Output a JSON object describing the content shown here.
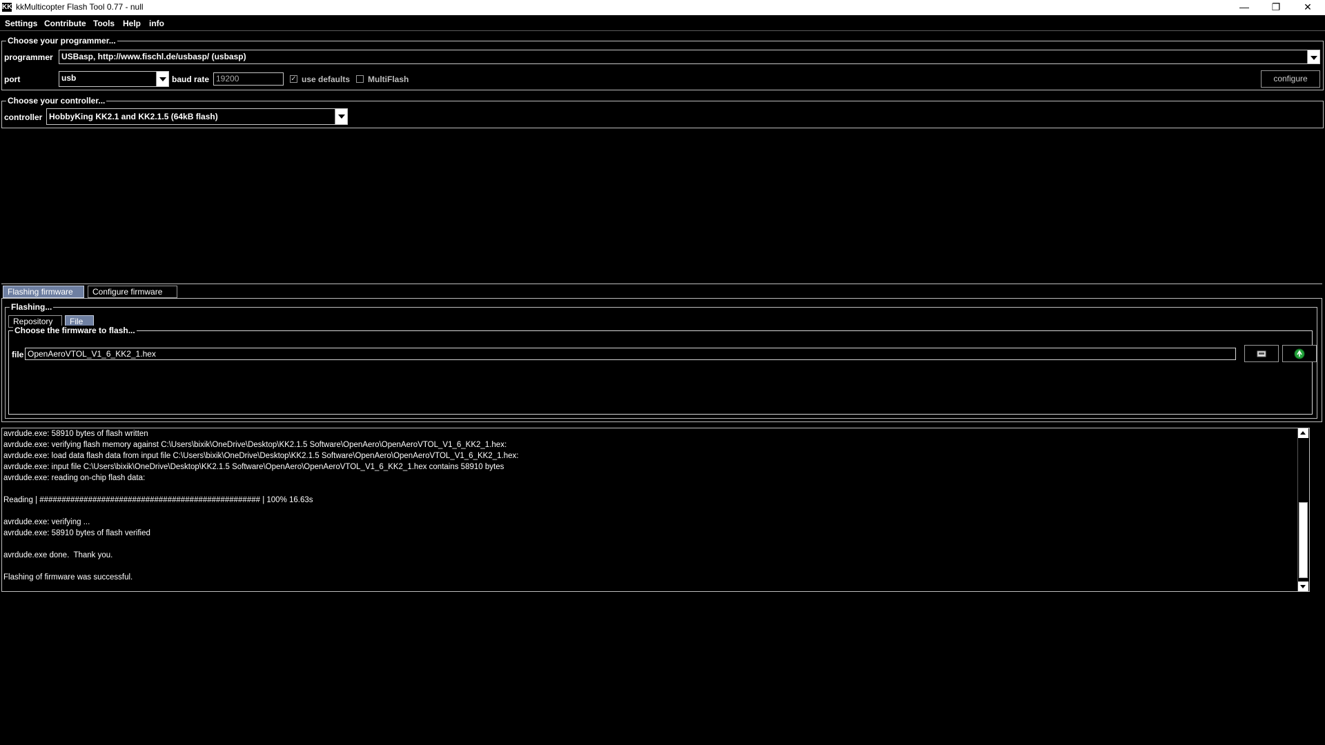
{
  "window": {
    "title": "kkMulticopter Flash Tool 0.77 - null",
    "icon": "KK",
    "minimize": "—",
    "restore": "❐",
    "close": "✕"
  },
  "menu": [
    "Settings",
    "Contribute",
    "Tools",
    "Help",
    "info"
  ],
  "programmer_group": {
    "title": "Choose your programmer...",
    "programmer_label": "programmer",
    "programmer_value": "USBasp, http://www.fischl.de/usbasp/ (usbasp)",
    "port_label": "port",
    "port_value": "usb",
    "baud_label": "baud rate",
    "baud_value": "19200",
    "use_defaults_label": "use defaults",
    "use_defaults_checked": true,
    "multiflash_label": "MultiFlash",
    "multiflash_checked": false,
    "configure_label": "configure"
  },
  "controller_group": {
    "title": "Choose your controller...",
    "controller_label": "controller",
    "controller_value": "HobbyKing KK2.1 and KK2.1.5 (64kB flash)"
  },
  "main_tabs": [
    {
      "label": "Flashing firmware",
      "selected": true
    },
    {
      "label": "Configure firmware",
      "selected": false
    }
  ],
  "flashing_group": {
    "title": "Flashing...",
    "tabs": [
      {
        "label": "Repository",
        "selected": false
      },
      {
        "label": "File",
        "selected": true
      }
    ],
    "choose_title": "Choose the firmware to flash...",
    "file_label": "file",
    "file_value": "OpenAeroVTOL_V1_6_KK2_1.hex",
    "open_icon": "folder-open-icon",
    "flash_icon": "flash-green-icon"
  },
  "log": {
    "lines": [
      "avrdude.exe: 58910 bytes of flash written",
      "avrdude.exe: verifying flash memory against C:\\Users\\bixik\\OneDrive\\Desktop\\KK2.1.5 Software\\OpenAero\\OpenAeroVTOL_V1_6_KK2_1.hex:",
      "avrdude.exe: load data flash data from input file C:\\Users\\bixik\\OneDrive\\Desktop\\KK2.1.5 Software\\OpenAero\\OpenAeroVTOL_V1_6_KK2_1.hex:",
      "avrdude.exe: input file C:\\Users\\bixik\\OneDrive\\Desktop\\KK2.1.5 Software\\OpenAero\\OpenAeroVTOL_V1_6_KK2_1.hex contains 58910 bytes",
      "avrdude.exe: reading on-chip flash data:",
      "",
      "Reading | ################################################## | 100% 16.63s",
      "",
      "avrdude.exe: verifying ...",
      "avrdude.exe: 58910 bytes of flash verified",
      "",
      "avrdude.exe done.  Thank you.",
      "",
      "Flashing of firmware was successful."
    ],
    "scroll_position": 0.95
  },
  "colors": {
    "background": "#000000",
    "tab_selected": "#6e7fa1",
    "flash_button_icon": "#22a23a"
  }
}
